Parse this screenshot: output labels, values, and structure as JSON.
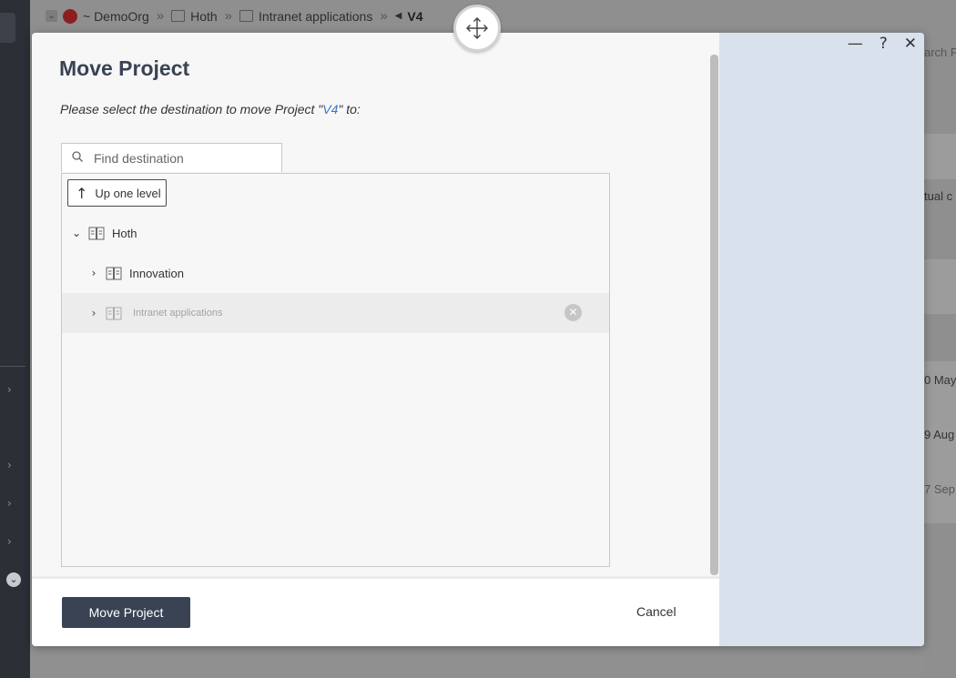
{
  "breadcrumb": {
    "org": "~ DemoOrg",
    "items": [
      "Hoth",
      "Intranet applications"
    ],
    "current": "V4",
    "separator": "»"
  },
  "background": {
    "search_fragment": "arch P",
    "column_fragment": "tual c",
    "dates": [
      "0 May",
      "9 Aug",
      "7 Sep"
    ]
  },
  "dialog": {
    "title": "Move Project",
    "subtitle_before": "Please select the destination to move Project \"",
    "project_name": "V4",
    "subtitle_after": "\" to:",
    "search": {
      "placeholder": "Find destination",
      "value": ""
    },
    "up_button_label": "Up one level",
    "tree": {
      "root": {
        "label": "Hoth",
        "expanded": true
      },
      "children": [
        {
          "label": "Innovation",
          "disabled": false
        },
        {
          "label": "Intranet applications",
          "disabled": true
        }
      ]
    },
    "primary_button_label": "Move Project",
    "cancel_label": "Cancel",
    "window_controls": {
      "minimize": "—",
      "help": "?",
      "close": "✕"
    }
  },
  "colors": {
    "primary": "#3a4354",
    "link": "#3b78c6",
    "side_panel": "#d9e2ec",
    "overlay": "#909090"
  },
  "icons": [
    "search-icon",
    "arrow-up-icon",
    "chevron-down-icon",
    "chevron-right-icon",
    "book-icon",
    "clear-icon",
    "move-icon",
    "minimize-icon",
    "help-icon",
    "close-icon"
  ]
}
